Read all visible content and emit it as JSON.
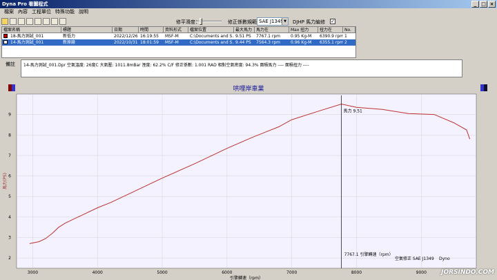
{
  "window": {
    "title": "Dyna Pro 看圖程式",
    "buttons": [
      "_",
      "□",
      "×"
    ]
  },
  "menu": [
    "檔案",
    "內容",
    "工程單位",
    "特殊功能",
    "說明"
  ],
  "toolbar": {
    "smoothing_label": "修平滑度：",
    "correction_label": "修正係數規範",
    "correction_value": "SAE J1349",
    "djhp_label": "DJHP 馬力編修",
    "djhp_checked": "✓"
  },
  "table": {
    "headers": [
      "檔案名稱",
      "標題",
      "日期",
      "時間",
      "資料形式",
      "檔案位置",
      "最大馬力",
      "馬力在",
      "Max 扭力",
      "扭力在",
      "No."
    ],
    "rows": [
      {
        "color": "#cc0000",
        "checked": "✓",
        "name": "18-馬力測試_001",
        "title": "新低力",
        "date": "2022/12/26",
        "time": "16:19:55",
        "type": "MSF-M",
        "path": "C:\\Documents and S...",
        "max_hp": "9.51 PS",
        "hp_at": "7767.1 rpm",
        "max_tq": "0.95 Kg-M",
        "tq_at": "6390.9 rpm",
        "no": "1"
      },
      {
        "color": "#0000cc",
        "checked": "",
        "name": "14-馬力測試_001",
        "title": "新原廠",
        "date": "2022/10/31",
        "time": "18:01:59",
        "type": "MSF-M",
        "path": "C:\\Documents and S...",
        "max_hp": "9.44 PS",
        "hp_at": "7564.3 rpm",
        "max_tq": "0.96 Kg-M",
        "tq_at": "6355.1 rpm",
        "no": "2"
      }
    ]
  },
  "note": {
    "label": "備註",
    "text": "14-馬力測試_001.Dpr   空氣溫度: 26度C   大氣壓: 1011.8mBar   溼度: 62.2%   C/F 修正係數: 1.001   RAD 相對空氣密度: 94.3%   面積馬力 ----   面積扭力 ----"
  },
  "chart": {
    "title": "哄哩岸車業",
    "cursor_label": "馬力 9.51",
    "cursor_rpm_label": "7767.1 引擎轉速（rpm）",
    "correction_note": "空氣修正 SAE J1349",
    "dyno_note": "Dyno",
    "watermark": "JORSINDO.COM"
  },
  "chart_data": {
    "type": "line",
    "xlabel": "引擎轉速（rpm）",
    "ylabel": "馬力(PS)",
    "xlim": [
      2750,
      9850
    ],
    "ylim": [
      1.5,
      10
    ],
    "x_ticks": [
      3000,
      4000,
      5000,
      6000,
      7000,
      8000,
      9000
    ],
    "y_ticks": [
      2,
      3,
      4,
      5,
      6,
      7,
      8,
      9
    ],
    "series": [
      {
        "name": "馬力",
        "color": "#c03030",
        "x": [
          2950,
          3100,
          3200,
          3300,
          3400,
          3500,
          3600,
          3800,
          4000,
          4200,
          4500,
          5000,
          5500,
          6000,
          6400,
          6800,
          7000,
          7400,
          7767,
          8000,
          8400,
          8800,
          9200,
          9500,
          9700,
          9750
        ],
        "y": [
          2.7,
          2.8,
          2.95,
          3.2,
          3.5,
          3.7,
          3.85,
          4.15,
          4.45,
          4.7,
          5.15,
          5.9,
          6.6,
          7.35,
          7.9,
          8.4,
          8.75,
          9.15,
          9.51,
          9.35,
          9.25,
          9.05,
          9.0,
          8.6,
          8.25,
          7.8
        ]
      }
    ]
  }
}
